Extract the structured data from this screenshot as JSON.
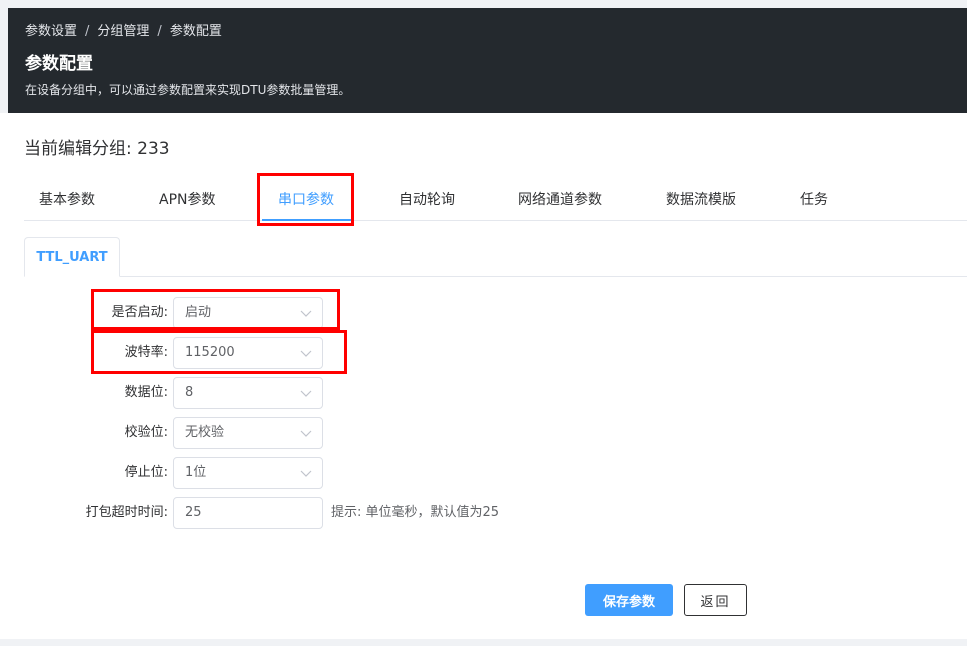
{
  "breadcrumb": {
    "items": [
      "参数设置",
      "分组管理",
      "参数配置"
    ],
    "separator": "/"
  },
  "header": {
    "title": "参数配置",
    "description": "在设备分组中，可以通过参数配置来实现DTU参数批量管理。"
  },
  "group": {
    "label": "当前编辑分组: 233"
  },
  "tabs": [
    {
      "label": "基本参数"
    },
    {
      "label": "APN参数"
    },
    {
      "label": "串口参数",
      "active": true
    },
    {
      "label": "自动轮询"
    },
    {
      "label": "网络通道参数"
    },
    {
      "label": "数据流模版"
    },
    {
      "label": "任务"
    }
  ],
  "subtab": {
    "label": "TTL_UART"
  },
  "form": {
    "enabled": {
      "label": "是否启动:",
      "value": "启动"
    },
    "baud": {
      "label": "波特率:",
      "value": "115200"
    },
    "databits": {
      "label": "数据位:",
      "value": "8"
    },
    "parity": {
      "label": "校验位:",
      "value": "无校验"
    },
    "stopbits": {
      "label": "停止位:",
      "value": "1位"
    },
    "timeout": {
      "label": "打包超时时间:",
      "value": "25",
      "hint": "提示: 单位毫秒，默认值为25"
    }
  },
  "buttons": {
    "save": "保存参数",
    "back": "返回"
  },
  "colors": {
    "accent": "#409eff",
    "header_bg": "#24292e",
    "highlight": "#ff0000"
  }
}
